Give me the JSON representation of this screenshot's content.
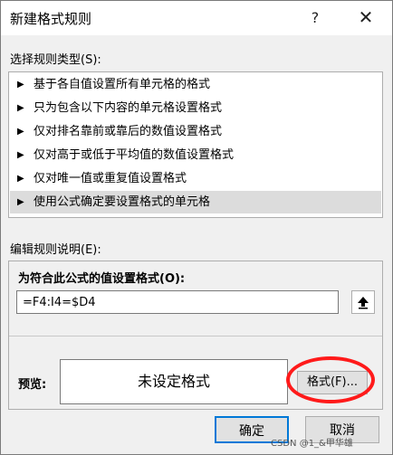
{
  "window": {
    "title": "新建格式规则",
    "help_label": "?",
    "close_label": "✕"
  },
  "rule_type": {
    "label": "选择规则类型(S):",
    "items": [
      {
        "label": "基于各自值设置所有单元格的格式"
      },
      {
        "label": "只为包含以下内容的单元格设置格式"
      },
      {
        "label": "仅对排名靠前或靠后的数值设置格式"
      },
      {
        "label": "仅对高于或低于平均值的数值设置格式"
      },
      {
        "label": "仅对唯一值或重复值设置格式"
      },
      {
        "label": "使用公式确定要设置格式的单元格",
        "selected": true
      }
    ],
    "arrow": "▶"
  },
  "edit_rule": {
    "label": "编辑规则说明(E):",
    "formula_title": "为符合此公式的值设置格式(O):",
    "formula_value": "=F4:I4=$D4",
    "preview_label": "预览:",
    "preview_text": "未设定格式",
    "format_button": "格式(F)..."
  },
  "footer": {
    "ok_label": "确定",
    "cancel_label": "取消"
  },
  "watermark": "CSDN @1_&甲华雄",
  "colors": {
    "highlight": "#ff1a1a",
    "ok_border": "#0078d7",
    "selected_row": "#dcdcdc"
  }
}
